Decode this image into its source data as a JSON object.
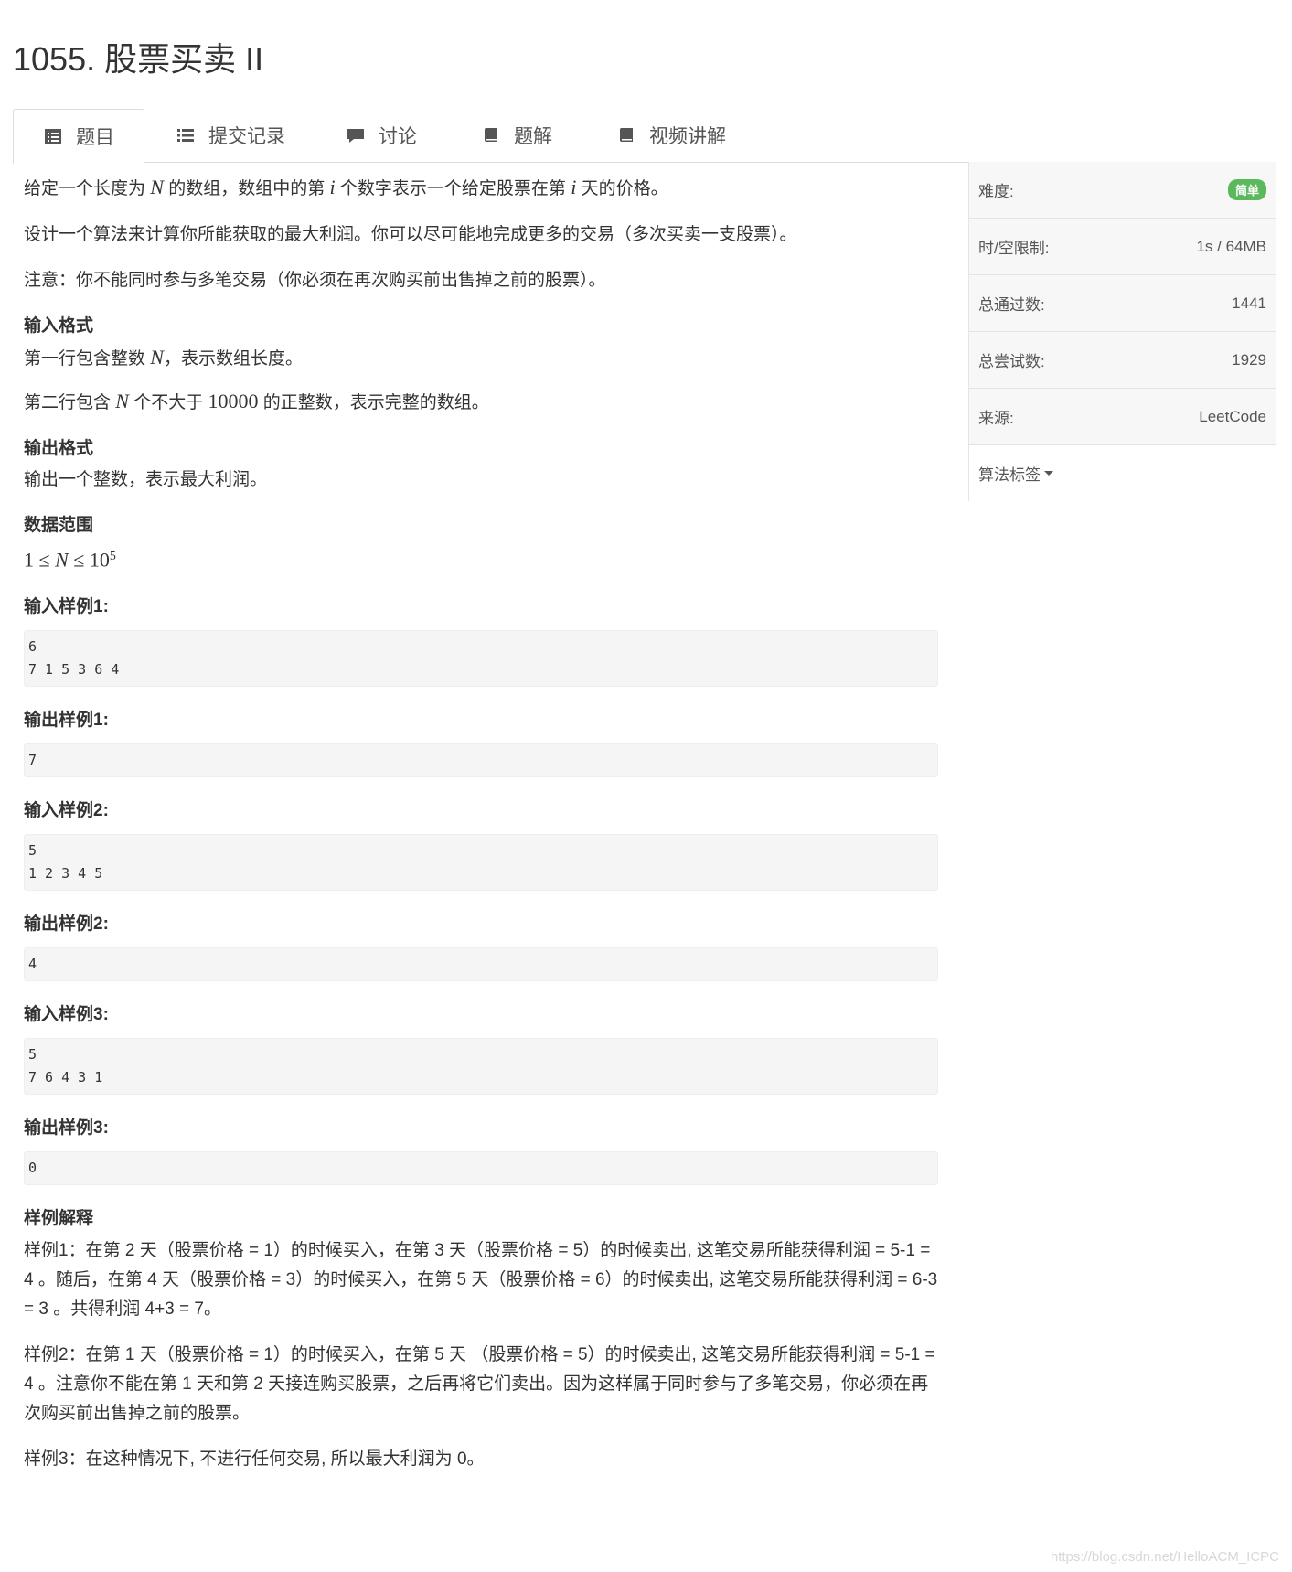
{
  "problem": {
    "title": "1055. 股票买卖 II"
  },
  "tabs": [
    {
      "label": "题目",
      "icon": "list-alt-icon",
      "active": true
    },
    {
      "label": "提交记录",
      "icon": "list-icon"
    },
    {
      "label": "讨论",
      "icon": "comment-icon"
    },
    {
      "label": "题解",
      "icon": "book-icon"
    },
    {
      "label": "视频讲解",
      "icon": "book-icon"
    }
  ],
  "description": {
    "p1": [
      "给定一个长度为 ",
      "N",
      " 的数组，数组中的第 ",
      "i",
      " 个数字表示一个给定股票在第 ",
      "i",
      " 天的价格。"
    ],
    "p2": "设计一个算法来计算你所能获取的最大利润。你可以尽可能地完成更多的交易（多次买卖一支股票）。",
    "p3": "注意：你不能同时参与多笔交易（你必须在再次购买前出售掉之前的股票）。"
  },
  "input_format": {
    "heading": "输入格式",
    "line1": [
      "第一行包含整数 ",
      "N",
      "，表示数组长度。"
    ],
    "line2": [
      "第二行包含 ",
      "N",
      " 个不大于 ",
      "10000",
      " 的正整数，表示完整的数组。"
    ]
  },
  "output_format": {
    "heading": "输出格式",
    "text": "输出一个整数，表示最大利润。"
  },
  "range": {
    "heading": "数据范围",
    "lhs": "1 ≤ ",
    "var": "N",
    "mid": " ≤ 10",
    "exp": "5"
  },
  "samples": [
    {
      "in_label": "输入样例1:",
      "in": "6\n7 1 5 3 6 4",
      "out_label": "输出样例1:",
      "out": "7"
    },
    {
      "in_label": "输入样例2:",
      "in": "5\n1 2 3 4 5",
      "out_label": "输出样例2:",
      "out": "4"
    },
    {
      "in_label": "输入样例3:",
      "in": "5\n7 6 4 3 1",
      "out_label": "输出样例3:",
      "out": "0"
    }
  ],
  "explanation": {
    "heading": "样例解释",
    "e1": "样例1：在第 2 天（股票价格 = 1）的时候买入，在第 3 天（股票价格 = 5）的时候卖出, 这笔交易所能获得利润 = 5-1 = 4 。随后，在第 4 天（股票价格 = 3）的时候买入，在第 5 天（股票价格 = 6）的时候卖出, 这笔交易所能获得利润 = 6-3 = 3 。共得利润 4+3 = 7。",
    "e2": "样例2：在第 1 天（股票价格 = 1）的时候买入，在第 5 天 （股票价格 = 5）的时候卖出, 这笔交易所能获得利润 = 5-1 = 4 。注意你不能在第 1 天和第 2 天接连购买股票，之后再将它们卖出。因为这样属于同时参与了多笔交易，你必须在再次购买前出售掉之前的股票。",
    "e3": "样例3：在这种情况下, 不进行任何交易, 所以最大利润为 0。"
  },
  "sidebar": {
    "difficulty_label": "难度:",
    "difficulty_value": "简单",
    "difficulty_color": "#5cb85c",
    "limit_label": "时/空限制:",
    "limit_value": "1s / 64MB",
    "passed_label": "总通过数:",
    "passed_value": "1441",
    "tried_label": "总尝试数:",
    "tried_value": "1929",
    "source_label": "来源:",
    "source_value": "LeetCode",
    "tags_label": "算法标签"
  },
  "watermark": "https://blog.csdn.net/HelloACM_ICPC"
}
